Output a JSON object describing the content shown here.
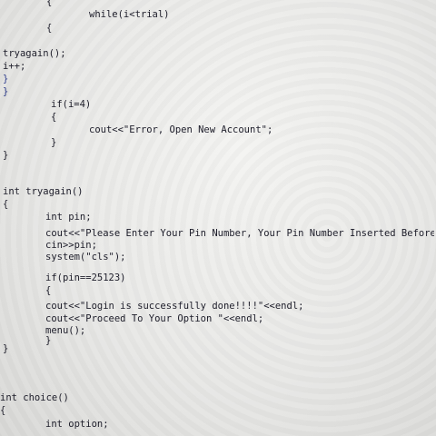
{
  "code_lines": [
    "{",
    "while(i<trial)",
    "{",
    "tryagain();",
    "i++;",
    "}",
    "}",
    "if(i=4)",
    "{",
    "cout<<\"Error, Open New Account\";",
    "}",
    "}",
    "int tryagain()",
    "{",
    "int pin;",
    "cout<<\"Please Enter Your Pin Number, Your Pin Number Inserted Before",
    "cin>>pin;",
    "system(\"cls\");",
    "if(pin==25123)",
    "{",
    "cout<<\"Login is successfully done!!!!\"<<endl;",
    "cout<<\"Proceed To Your Option \"<<endl;",
    "menu();",
    "}",
    "}",
    "int choice()",
    "{",
    "int option;"
  ]
}
